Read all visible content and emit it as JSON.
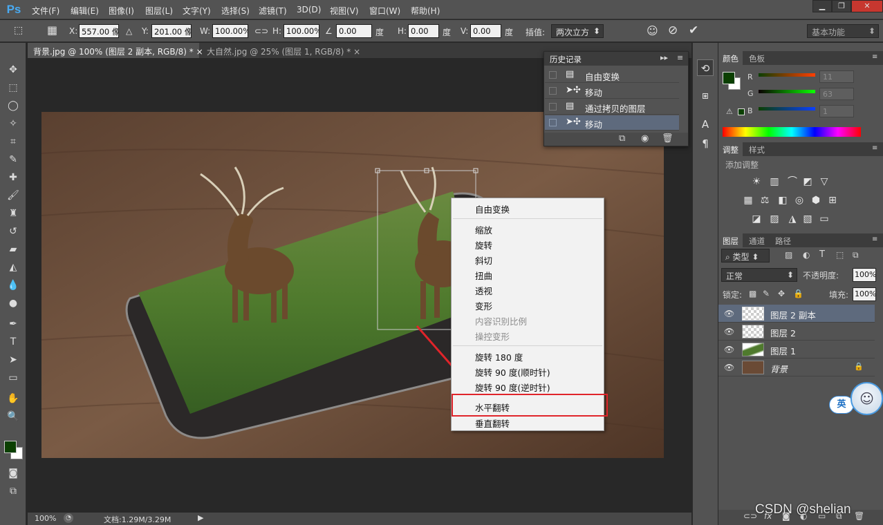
{
  "app": {
    "logo": "Ps"
  },
  "menu": [
    "文件(F)",
    "编辑(E)",
    "图像(I)",
    "图层(L)",
    "文字(Y)",
    "选择(S)",
    "滤镜(T)",
    "3D(D)",
    "视图(V)",
    "窗口(W)",
    "帮助(H)"
  ],
  "options": {
    "x_label": "X:",
    "x_value": "557.00 像",
    "y_label": "Y:",
    "y_value": "201.00 像",
    "w_label": "W:",
    "w_value": "100.00%",
    "h_label": "H:",
    "h_value": "100.00%",
    "angle_value": "0.00",
    "deg": "度",
    "hskew_label": "H:",
    "hskew_value": "0.00",
    "vskew_label": "V:",
    "vskew_value": "0.00",
    "interp_label": "插值:",
    "interp_value": "两次立方",
    "workspace": "基本功能"
  },
  "tabs": [
    {
      "label": "背景.jpg @ 100% (图层 2 副本, RGB/8) *",
      "close": "×"
    },
    {
      "label": "大自然.jpg @ 25% (图层 1, RGB/8) *",
      "close": "×"
    }
  ],
  "history": {
    "title": "历史记录",
    "items": [
      {
        "label": "自由变换",
        "icon": "document-icon"
      },
      {
        "label": "移动",
        "icon": "move-icon"
      },
      {
        "label": "通过拷贝的图层",
        "icon": "document-icon"
      },
      {
        "label": "移动",
        "icon": "move-icon"
      }
    ]
  },
  "context_menu": {
    "items": [
      "自由变换",
      "缩放",
      "旋转",
      "斜切",
      "扭曲",
      "透视",
      "变形",
      "内容识别比例",
      "操控变形",
      "旋转 180 度",
      "旋转 90 度(顺时针)",
      "旋转 90 度(逆时针)",
      "水平翻转",
      "垂直翻转"
    ],
    "highlight": "水平翻转",
    "highlight_color": "#e0242a"
  },
  "color_panel": {
    "tabs": [
      "颜色",
      "色板"
    ],
    "r_label": "R",
    "g_label": "G",
    "b_label": "B",
    "r": "11",
    "g": "63",
    "b": "1",
    "fg": "#0b3f01",
    "bg": "#ffffff"
  },
  "adjust_panel": {
    "tabs": [
      "调整",
      "样式"
    ],
    "title": "添加调整"
  },
  "layers_panel": {
    "tabs": [
      "图层",
      "通道",
      "路径"
    ],
    "filter_label": "类型",
    "blend_mode": "正常",
    "opacity_label": "不透明度:",
    "opacity": "100%",
    "lock_label": "锁定:",
    "fill_label": "填充:",
    "fill": "100%",
    "layers": [
      {
        "name": "图层 2 副本",
        "selected": true
      },
      {
        "name": "图层 2",
        "selected": false
      },
      {
        "name": "图层 1",
        "selected": false
      },
      {
        "name": "背景",
        "selected": false,
        "locked": true
      }
    ]
  },
  "status": {
    "zoom": "100%",
    "doc": "文档:1.29M/3.29M"
  },
  "ime": {
    "label": "英"
  },
  "watermark": "CSDN @shelian"
}
